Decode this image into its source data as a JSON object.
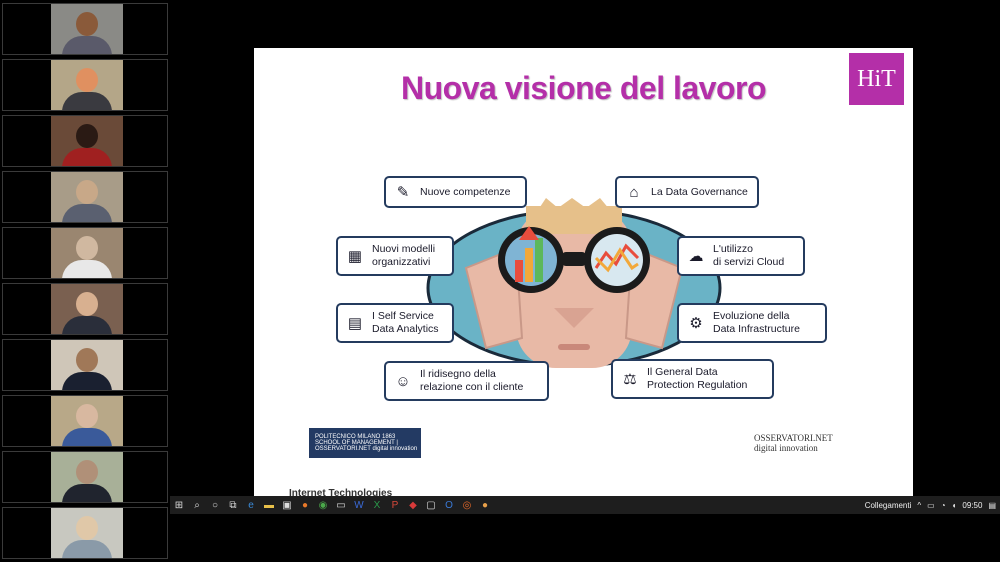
{
  "slide": {
    "title": "Nuova visione del lavoro",
    "logo": "HiT",
    "cards_left": [
      {
        "label": "Nuove competenze",
        "icon": "pencil-cup-icon"
      },
      {
        "label": "Nuovi modelli\norganizzativi",
        "icon": "org-chart-icon"
      },
      {
        "label": "I Self Service\nData Analytics",
        "icon": "analytics-icon"
      },
      {
        "label": "Il ridisegno della\nrelazione con il cliente",
        "icon": "customer-icon"
      }
    ],
    "cards_right": [
      {
        "label": "La Data Governance",
        "icon": "bank-icon"
      },
      {
        "label": "L'utilizzo\ndi servizi Cloud",
        "icon": "cloud-icon"
      },
      {
        "label": "Evoluzione della\nData Infrastructure",
        "icon": "network-icon"
      },
      {
        "label": "Il General Data\nProtection Regulation",
        "icon": "gdpr-icon"
      }
    ],
    "footer_left": "POLITECNICO MILANO 1863 SCHOOL OF MANAGEMENT | OSSERVATORI.NET digital innovation",
    "footer_right_line1": "OSSERVATORI.NET",
    "footer_right_line2": "digital innovation",
    "ticker": "Internet Technologies"
  },
  "taskbar": {
    "network_label": "Collegamenti",
    "time": "09:50",
    "colors": {
      "background": "#1e1e1e"
    }
  },
  "participants_count": 10,
  "colors": {
    "accent": "#b42fa8",
    "card_border": "#243b5e"
  }
}
